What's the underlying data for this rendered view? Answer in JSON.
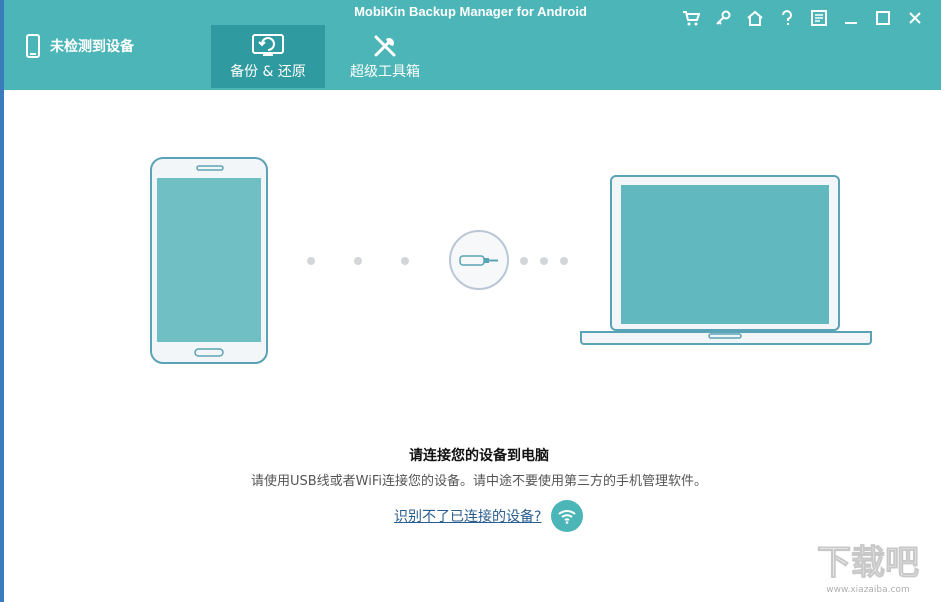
{
  "window": {
    "title": "MobiKin Backup Manager for Android"
  },
  "header": {
    "device_status": "未检测到设备",
    "tabs": [
      {
        "label": "备份 & 还原",
        "icon": "backup-restore-icon",
        "active": true
      },
      {
        "label": "超级工具箱",
        "icon": "tools-icon",
        "active": false
      }
    ],
    "toolbar_icons": [
      "cart-icon",
      "key-icon",
      "home-icon",
      "help-icon",
      "feedback-icon",
      "minimize-icon",
      "maximize-icon",
      "close-icon"
    ]
  },
  "main": {
    "connect_title": "请连接您的设备到电脑",
    "connect_hint": "请使用USB线或者WiFi连接您的设备。请中途不要使用第三方的手机管理软件。",
    "help_link": "识别不了已连接的设备?"
  },
  "watermark": {
    "text": "下载吧",
    "url_text": "www.xiazaiba.com"
  },
  "colors": {
    "header": "#4cb5b8",
    "active_tab": "#2f9a9f",
    "screen": "#62b8bf",
    "device_border": "#5aa3b6",
    "link": "#2a5d8f"
  }
}
